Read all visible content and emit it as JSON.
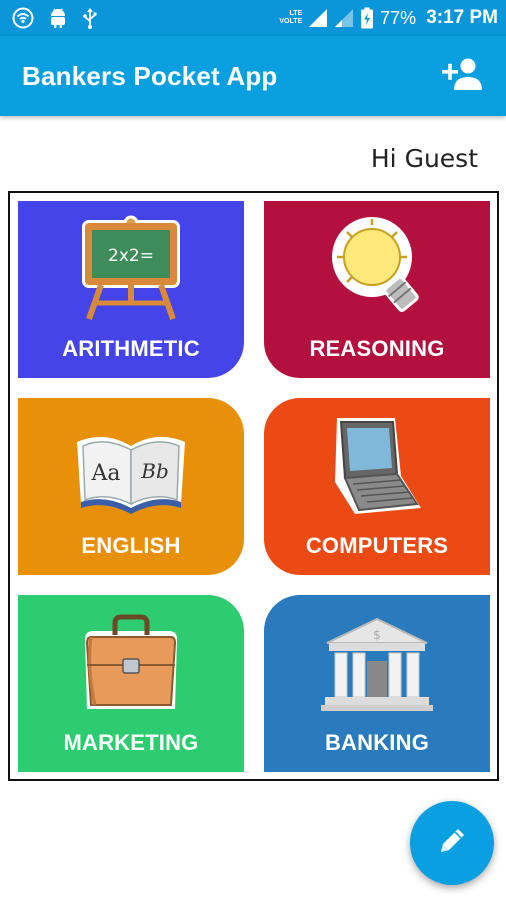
{
  "status_bar": {
    "battery_percent": "77%",
    "time": "3:17 PM",
    "network_label_top": "LTE",
    "network_label_bottom": "VOLTE",
    "icons": [
      "wifi-hotspot-icon",
      "android-icon",
      "usb-icon",
      "signal-icon",
      "signal-weak-icon",
      "battery-charging-icon"
    ]
  },
  "app_bar": {
    "title": "Bankers Pocket App",
    "action_icon": "add-user-icon"
  },
  "greeting": "Hi Guest",
  "tiles": [
    {
      "label": "ARITHMETIC",
      "icon": "chalkboard-icon",
      "color": "#4444e8"
    },
    {
      "label": "REASONING",
      "icon": "lightbulb-icon",
      "color": "#b4103d"
    },
    {
      "label": "ENGLISH",
      "icon": "book-icon",
      "color": "#e8900a"
    },
    {
      "label": "COMPUTERS",
      "icon": "laptop-icon",
      "color": "#ec4a14"
    },
    {
      "label": "MARKETING",
      "icon": "briefcase-icon",
      "color": "#2ecc71"
    },
    {
      "label": "BANKING",
      "icon": "bank-building-icon",
      "color": "#2a7bbd"
    }
  ],
  "chalkboard_text": "2x2=",
  "book_text": {
    "left": "Aa",
    "right": "Bb"
  },
  "bank_sign": "$",
  "fab_icon": "pencil-icon",
  "colors": {
    "primary": "#0aa0df",
    "status_bar": "#0a96d8"
  }
}
